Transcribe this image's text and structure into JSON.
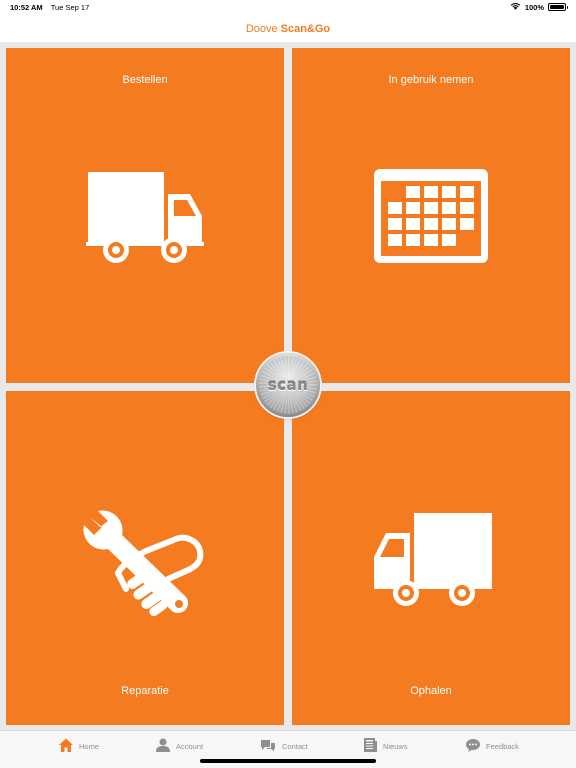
{
  "status": {
    "time": "10:52 AM",
    "date": "Tue Sep 17",
    "battery": "100%",
    "battery_level": 1.0
  },
  "nav": {
    "brand_light": "Doove",
    "brand_strong": "Scan&Go"
  },
  "tiles": [
    {
      "label": "Bestellen",
      "icon": "truck-icon"
    },
    {
      "label": "In gebruik nemen",
      "icon": "calendar-icon"
    },
    {
      "label": "Reparatie",
      "icon": "wrench-hand-icon"
    },
    {
      "label": "Ophalen",
      "icon": "truck-icon"
    }
  ],
  "scan": {
    "label": "scan"
  },
  "tabs": [
    {
      "label": "Home",
      "icon": "home-icon"
    },
    {
      "label": "Account",
      "icon": "person-icon"
    },
    {
      "label": "Contact",
      "icon": "chat-bubbles-icon"
    },
    {
      "label": "Nieuws",
      "icon": "newspaper-icon"
    },
    {
      "label": "Feedback",
      "icon": "speech-bubble-icon"
    }
  ],
  "colors": {
    "accent": "#f47b20",
    "active_tab": "#f57a22",
    "inactive_tab": "#8e8e93"
  }
}
